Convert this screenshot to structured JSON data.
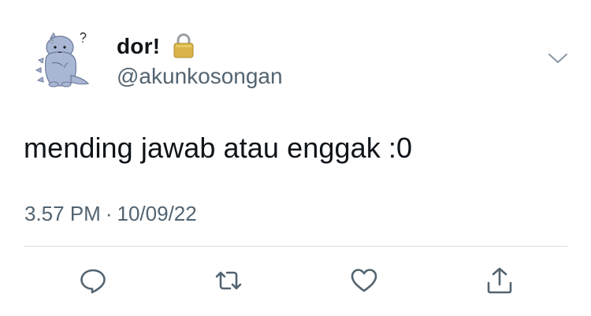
{
  "tweet": {
    "author": {
      "display_name": "dor!",
      "handle": "@akunkosongan",
      "protected_icon": "lock-icon",
      "avatar_icon": "dinosaur-avatar"
    },
    "text": "mending jawab atau enggak :0",
    "time": "3.57 PM",
    "separator": "·",
    "date": "10/09/22"
  },
  "actions": [
    {
      "name": "reply",
      "icon": "comment-icon"
    },
    {
      "name": "retweet",
      "icon": "retweet-icon"
    },
    {
      "name": "like",
      "icon": "heart-icon"
    },
    {
      "name": "share",
      "icon": "share-icon"
    }
  ],
  "colors": {
    "text": "#0f1419",
    "secondary": "#536471",
    "divider": "#d9dee1",
    "avatar": "#a9b7d4"
  }
}
